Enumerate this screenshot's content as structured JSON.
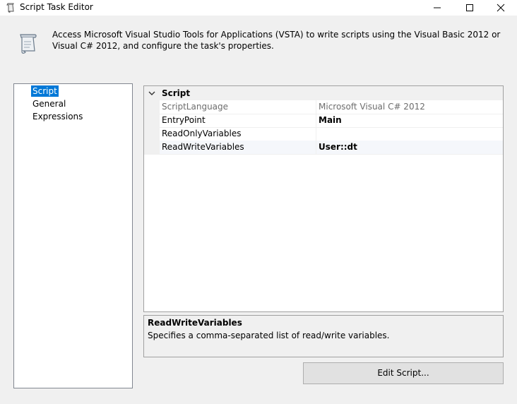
{
  "window": {
    "title": "Script Task Editor",
    "controls": {
      "minimize": "minimize-icon",
      "maximize": "maximize-icon",
      "close": "close-icon"
    }
  },
  "header": {
    "icon": "script-scroll-icon",
    "description": "Access Microsoft Visual Studio Tools for Applications (VSTA) to write scripts using the Visual Basic 2012 or Visual C# 2012, and configure the task's properties."
  },
  "nav": {
    "items": [
      {
        "label": "Script",
        "selected": true
      },
      {
        "label": "General",
        "selected": false
      },
      {
        "label": "Expressions",
        "selected": false
      }
    ]
  },
  "property_grid": {
    "category": "Script",
    "properties": [
      {
        "name": "ScriptLanguage",
        "value": "Microsoft Visual C# 2012",
        "disabled": true
      },
      {
        "name": "EntryPoint",
        "value": "Main",
        "bold": true
      },
      {
        "name": "ReadOnlyVariables",
        "value": ""
      },
      {
        "name": "ReadWriteVariables",
        "value": "User::dt",
        "bold": true,
        "selected": true
      }
    ]
  },
  "help": {
    "title": "ReadWriteVariables",
    "text": "Specifies a comma-separated list of read/write variables."
  },
  "buttons": {
    "edit_script": "Edit Script..."
  },
  "colors": {
    "selection": "#0078d7",
    "window_bg": "#f0f0f0",
    "row_selected": "#f5f7fb"
  }
}
